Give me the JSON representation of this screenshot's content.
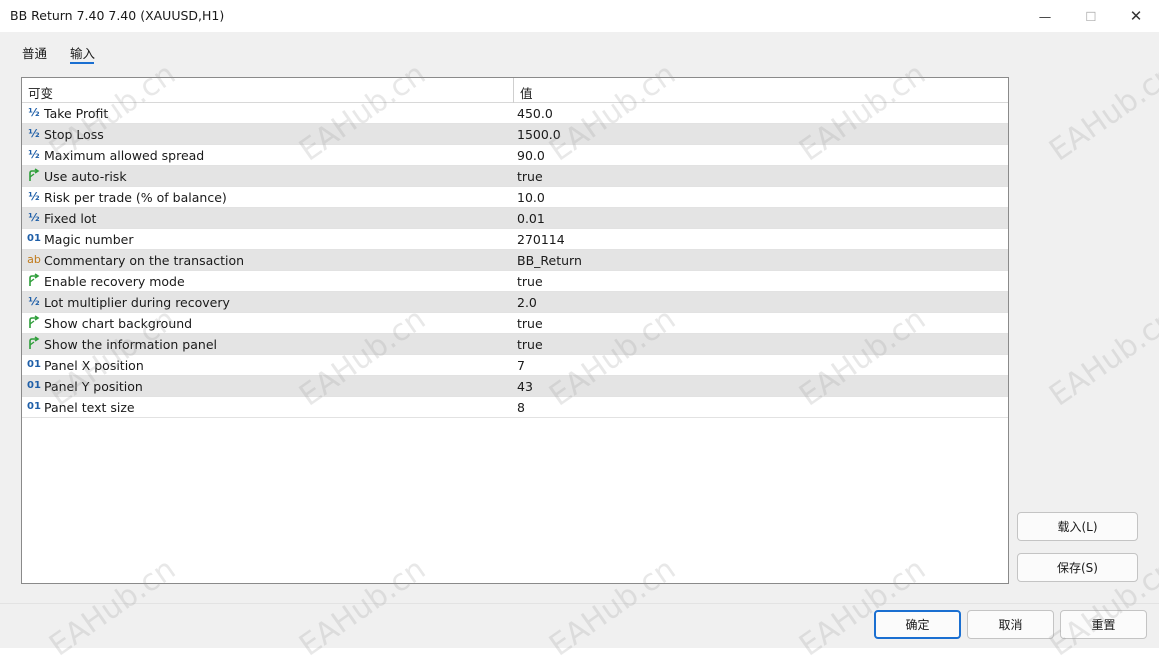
{
  "window": {
    "title": "BB Return 7.40 7.40 (XAUUSD,H1)",
    "minimize_glyph": "—",
    "maximize_glyph": "☐",
    "close_glyph": "✕"
  },
  "tabs": [
    {
      "label": "普通"
    },
    {
      "label": "输入"
    }
  ],
  "grid": {
    "header_variable": "可变",
    "header_value": "值",
    "rows": [
      {
        "icon": "half-icon",
        "type_glyph": "½",
        "name": "Take Profit",
        "value": "450.0"
      },
      {
        "icon": "half-icon",
        "type_glyph": "½",
        "name": "Stop Loss",
        "value": "1500.0"
      },
      {
        "icon": "half-icon",
        "type_glyph": "½",
        "name": "Maximum allowed spread",
        "value": "90.0"
      },
      {
        "icon": "bool-arrow-icon",
        "type_glyph": "",
        "name": "Use auto-risk",
        "value": "true"
      },
      {
        "icon": "half-icon",
        "type_glyph": "½",
        "name": "Risk per trade (% of balance)",
        "value": "10.0"
      },
      {
        "icon": "half-icon",
        "type_glyph": "½",
        "name": "Fixed lot",
        "value": "0.01"
      },
      {
        "icon": "int-icon",
        "type_glyph": "01",
        "name": "Magic number",
        "value": "270114"
      },
      {
        "icon": "string-icon",
        "type_glyph": "ab",
        "name": "Commentary on the transaction",
        "value": "BB_Return"
      },
      {
        "icon": "bool-arrow-icon",
        "type_glyph": "",
        "name": "Enable recovery mode",
        "value": "true"
      },
      {
        "icon": "half-icon",
        "type_glyph": "½",
        "name": "Lot multiplier during recovery",
        "value": "2.0"
      },
      {
        "icon": "bool-arrow-icon",
        "type_glyph": "",
        "name": "Show chart background",
        "value": "true"
      },
      {
        "icon": "bool-arrow-icon",
        "type_glyph": "",
        "name": "Show the information panel",
        "value": "true"
      },
      {
        "icon": "int-icon",
        "type_glyph": "01",
        "name": "Panel X position",
        "value": "7"
      },
      {
        "icon": "int-icon",
        "type_glyph": "01",
        "name": "Panel Y position",
        "value": "43"
      },
      {
        "icon": "int-icon",
        "type_glyph": "01",
        "name": "Panel text size",
        "value": "8"
      }
    ]
  },
  "side_buttons": {
    "load": "载入(L)",
    "save": "保存(S)"
  },
  "footer_buttons": {
    "ok": "确定",
    "cancel": "取消",
    "reset": "重置"
  },
  "watermark_text": "EAHub.cn",
  "colors": {
    "accent": "#1a6fd1",
    "bool_icon": "#2e9e3a",
    "numeric_icon": "#1f5fa8",
    "string_icon": "#c07a1a"
  }
}
